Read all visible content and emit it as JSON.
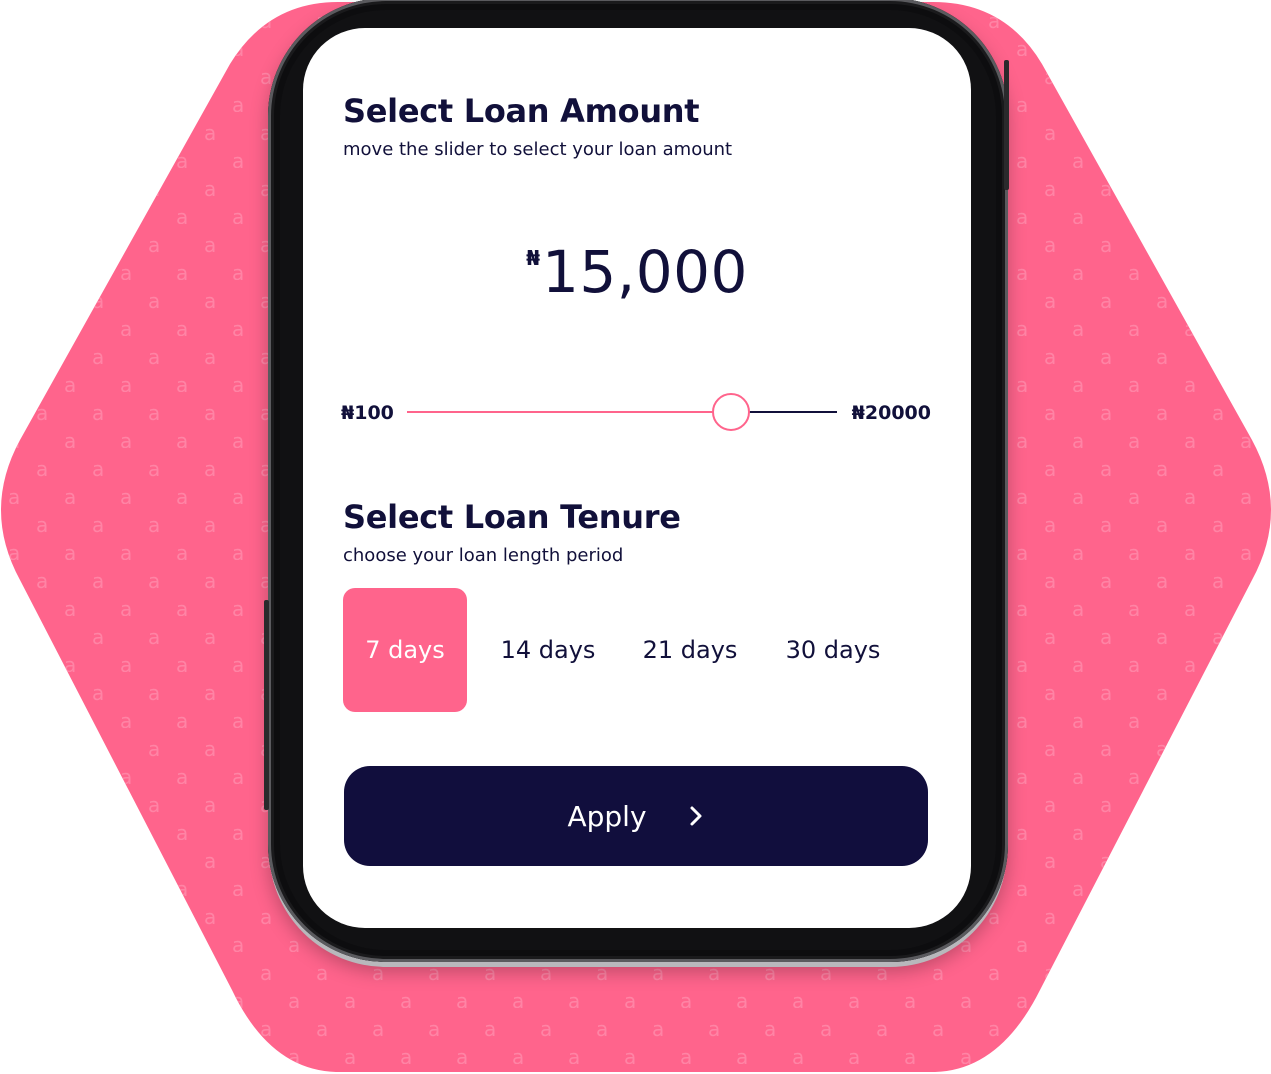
{
  "colors": {
    "accent": "#ff648c",
    "navy": "#110e3d",
    "text": "#11103a"
  },
  "amount_section": {
    "title": "Select Loan Amount",
    "subtitle": "move the slider to select your loan amount",
    "currency_symbol": "₦",
    "amount": "15,000"
  },
  "slider": {
    "min_label": "₦100",
    "max_label": "₦20000",
    "value_fraction": 0.75
  },
  "tenure_section": {
    "title": "Select Loan Tenure",
    "subtitle": "choose your loan length period",
    "options": [
      {
        "label": "7 days",
        "selected": true
      },
      {
        "label": "14 days",
        "selected": false
      },
      {
        "label": "21 days",
        "selected": false
      },
      {
        "label": "30 days",
        "selected": false
      }
    ]
  },
  "apply_button": {
    "label": "Apply",
    "icon": "chevron-right-icon"
  },
  "background": {
    "pattern_glyph": "a"
  }
}
